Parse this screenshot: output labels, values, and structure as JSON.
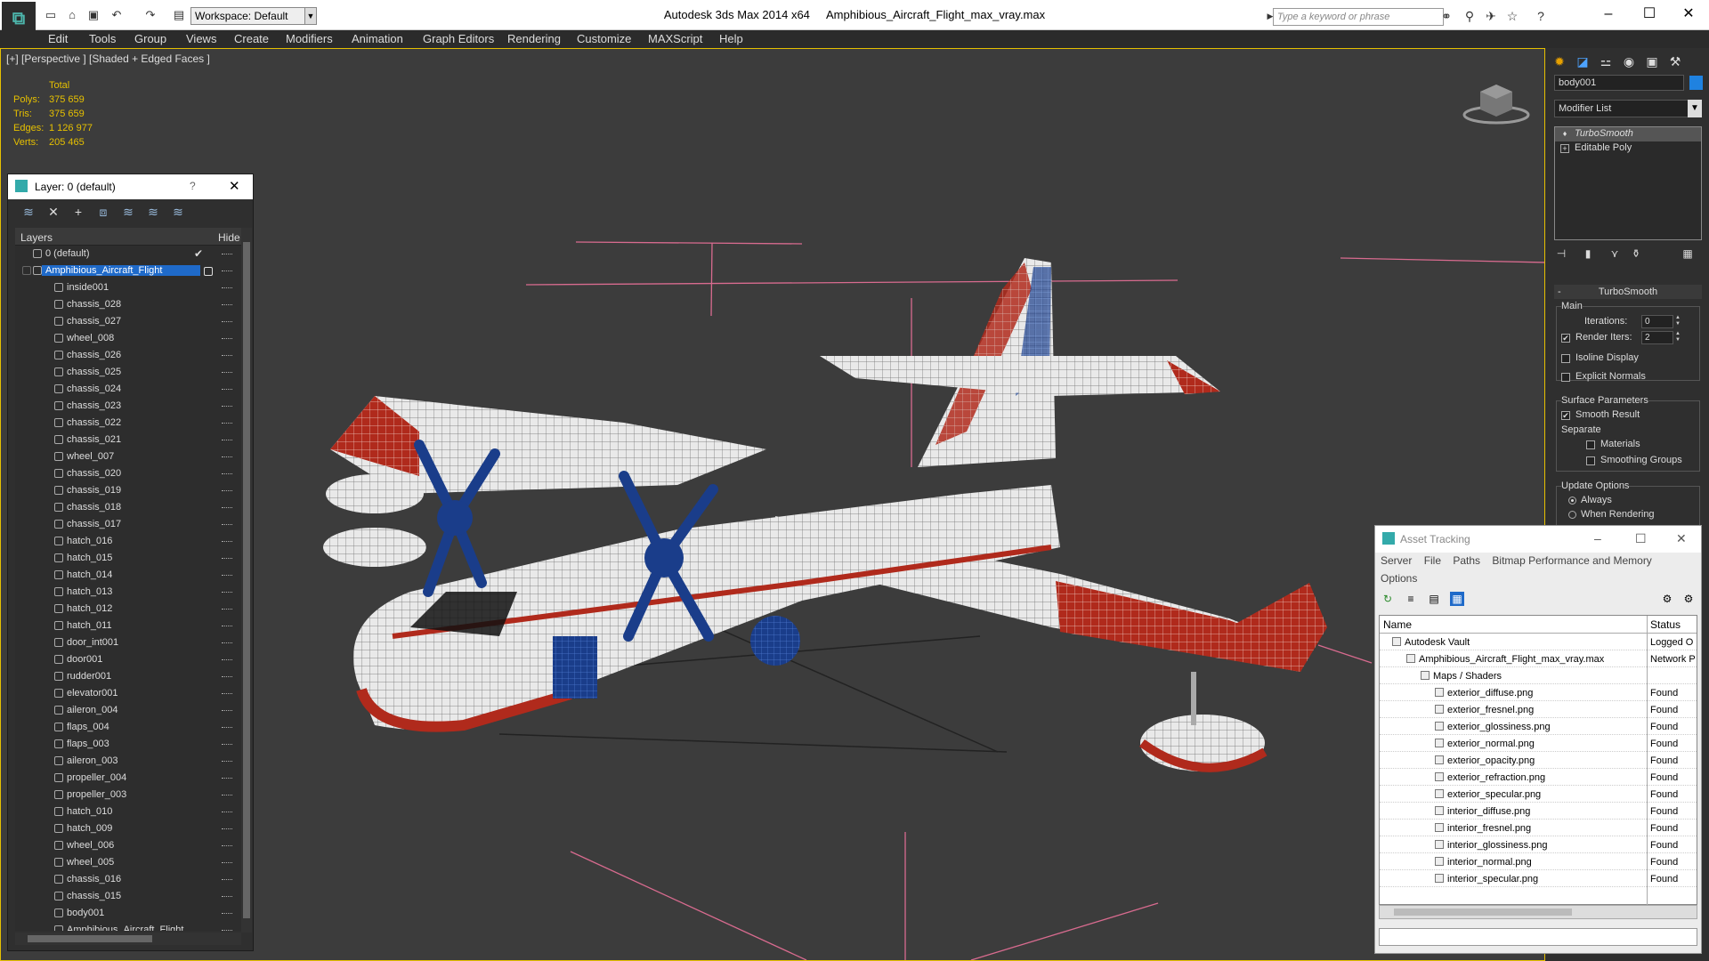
{
  "window": {
    "app_name": "Autodesk 3ds Max  2014 x64",
    "file_name": "Amphibious_Aircraft_Flight_max_vray.max",
    "workspace": "Workspace: Default",
    "search_placeholder": "Type a keyword or phrase"
  },
  "menu": [
    "Edit",
    "Tools",
    "Group",
    "Views",
    "Create",
    "Modifiers",
    "Animation",
    "Graph Editors",
    "Rendering",
    "Customize",
    "MAXScript",
    "Help"
  ],
  "viewport": {
    "label": "[+] [Perspective ] [Shaded + Edged Faces ]",
    "stats": {
      "total_label": "Total",
      "rows": [
        {
          "label": "Polys:",
          "value": "375 659"
        },
        {
          "label": "Tris:",
          "value": "375 659"
        },
        {
          "label": "Edges:",
          "value": "1 126 977"
        },
        {
          "label": "Verts:",
          "value": "205 465"
        }
      ]
    }
  },
  "layer_panel": {
    "title": "Layer: 0 (default)",
    "help": "?",
    "col_layers": "Layers",
    "col_hide": "Hide",
    "default_layer": "0 (default)",
    "selected_layer": "Amphibious_Aircraft_Flight",
    "objects": [
      "inside001",
      "chassis_028",
      "chassis_027",
      "wheel_008",
      "chassis_026",
      "chassis_025",
      "chassis_024",
      "chassis_023",
      "chassis_022",
      "chassis_021",
      "wheel_007",
      "chassis_020",
      "chassis_019",
      "chassis_018",
      "chassis_017",
      "hatch_016",
      "hatch_015",
      "hatch_014",
      "hatch_013",
      "hatch_012",
      "hatch_011",
      "door_int001",
      "door001",
      "rudder001",
      "elevator001",
      "aileron_004",
      "flaps_004",
      "flaps_003",
      "aileron_003",
      "propeller_004",
      "propeller_003",
      "hatch_010",
      "hatch_009",
      "wheel_006",
      "wheel_005",
      "chassis_016",
      "chassis_015",
      "body001",
      "Amphibious_Aircraft_Flight"
    ]
  },
  "command_panel": {
    "object_name": "body001",
    "object_color": "#1f82e0",
    "modifier_list": "Modifier List",
    "stack": [
      "TurboSmooth",
      "Editable Poly"
    ],
    "rollout_title": "TurboSmooth",
    "main": "Main",
    "iterations_label": "Iterations:",
    "iterations_value": "0",
    "render_iters_label": "Render Iters:",
    "render_iters_value": "2",
    "isoline": "Isoline Display",
    "explicit_normals": "Explicit Normals",
    "surface_params": "Surface Parameters",
    "smooth_result": "Smooth Result",
    "separate": "Separate",
    "materials": "Materials",
    "smoothing_groups": "Smoothing Groups",
    "update_options": "Update Options",
    "always": "Always",
    "when_rendering": "When Rendering"
  },
  "asset_tracking": {
    "title": "Asset Tracking",
    "menu": [
      "Server",
      "File",
      "Paths",
      "Bitmap Performance and Memory"
    ],
    "menu2": "Options",
    "col_name": "Name",
    "col_status": "Status",
    "rows": [
      {
        "name": "Autodesk Vault",
        "status": "Logged O",
        "indent": 1
      },
      {
        "name": "Amphibious_Aircraft_Flight_max_vray.max",
        "status": "Network P",
        "indent": 2
      },
      {
        "name": "Maps / Shaders",
        "status": "",
        "indent": 3
      },
      {
        "name": "exterior_diffuse.png",
        "status": "Found",
        "indent": 4
      },
      {
        "name": "exterior_fresnel.png",
        "status": "Found",
        "indent": 4
      },
      {
        "name": "exterior_glossiness.png",
        "status": "Found",
        "indent": 4
      },
      {
        "name": "exterior_normal.png",
        "status": "Found",
        "indent": 4
      },
      {
        "name": "exterior_opacity.png",
        "status": "Found",
        "indent": 4
      },
      {
        "name": "exterior_refraction.png",
        "status": "Found",
        "indent": 4
      },
      {
        "name": "exterior_specular.png",
        "status": "Found",
        "indent": 4
      },
      {
        "name": "interior_diffuse.png",
        "status": "Found",
        "indent": 4
      },
      {
        "name": "interior_fresnel.png",
        "status": "Found",
        "indent": 4
      },
      {
        "name": "interior_glossiness.png",
        "status": "Found",
        "indent": 4
      },
      {
        "name": "interior_normal.png",
        "status": "Found",
        "indent": 4
      },
      {
        "name": "interior_specular.png",
        "status": "Found",
        "indent": 4
      }
    ]
  }
}
